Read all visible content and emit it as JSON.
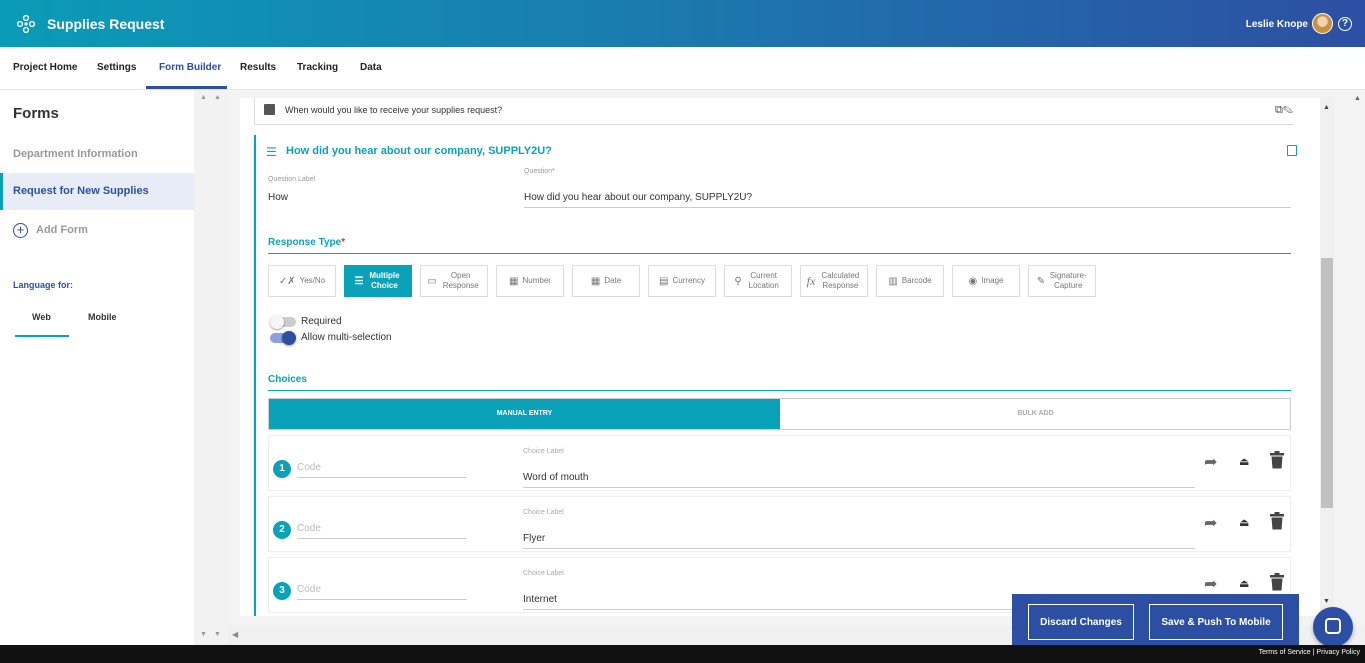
{
  "app": {
    "title": "Supplies Request",
    "user": "Leslie Knope",
    "help_glyph": "?"
  },
  "nav": {
    "tabs": [
      "Project Home",
      "Settings",
      "Form Builder",
      "Results",
      "Tracking",
      "Data"
    ],
    "active": "Form Builder"
  },
  "sidebar": {
    "title": "Forms",
    "items": [
      "Department Information",
      "Request for New Supplies"
    ],
    "active_item": "Request for New Supplies",
    "add_form": "Add Form",
    "language_label": "Language for:",
    "language_tabs": [
      "Web",
      "Mobile"
    ],
    "active_language": "Web"
  },
  "collapsed_question": {
    "text": "When would you like to receive your supplies request?"
  },
  "question": {
    "title": "How did you hear about our company, SUPPLY2U?",
    "label_caption": "Question Label",
    "label_value": "How",
    "question_caption": "Question*",
    "question_value": "How did you hear about our company, SUPPLY2U?"
  },
  "response_type": {
    "title": "Response Type",
    "required_mark": "*",
    "options": [
      {
        "icon": "yes-no-icon",
        "glyph": "✓✗",
        "label": "Yes/No"
      },
      {
        "icon": "multiple-choice-icon",
        "glyph": "☰",
        "label": "Multiple Choice"
      },
      {
        "icon": "open-response-icon",
        "glyph": "▭",
        "label": "Open Response"
      },
      {
        "icon": "number-icon",
        "glyph": "▦",
        "label": "Number"
      },
      {
        "icon": "date-icon",
        "glyph": "▦",
        "label": "Date"
      },
      {
        "icon": "currency-icon",
        "glyph": "▤",
        "label": "Currency"
      },
      {
        "icon": "location-pin-icon",
        "glyph": "⚲",
        "label": "Current Location"
      },
      {
        "icon": "function-icon",
        "glyph": "fx",
        "label": "Calculated Response"
      },
      {
        "icon": "barcode-icon",
        "glyph": "▥",
        "label": "Barcode"
      },
      {
        "icon": "camera-icon",
        "glyph": "◉",
        "label": "Image"
      },
      {
        "icon": "pen-icon",
        "glyph": "✎",
        "label": "Signature-Capture"
      }
    ],
    "selected": "Multiple Choice"
  },
  "toggles": [
    {
      "label": "Required",
      "on": false
    },
    {
      "label": "Allow multi-selection",
      "on": true
    }
  ],
  "choices": {
    "title": "Choices",
    "tabs": [
      "MANUAL ENTRY",
      "BULK ADD"
    ],
    "active_tab": "MANUAL ENTRY",
    "code_placeholder": "Code",
    "label_caption": "Choice Label",
    "items": [
      {
        "num": "1",
        "label": "Word of mouth"
      },
      {
        "num": "2",
        "label": "Flyer"
      },
      {
        "num": "3",
        "label": "Internet"
      }
    ]
  },
  "footer": {
    "discard": "Discard Changes",
    "save": "Save & Push To Mobile"
  },
  "bottom": {
    "terms": "Terms of Service",
    "sep": " | ",
    "privacy": "Privacy Policy"
  },
  "colors": {
    "teal": "#0aa2b9",
    "blue": "#2d4fa3"
  }
}
